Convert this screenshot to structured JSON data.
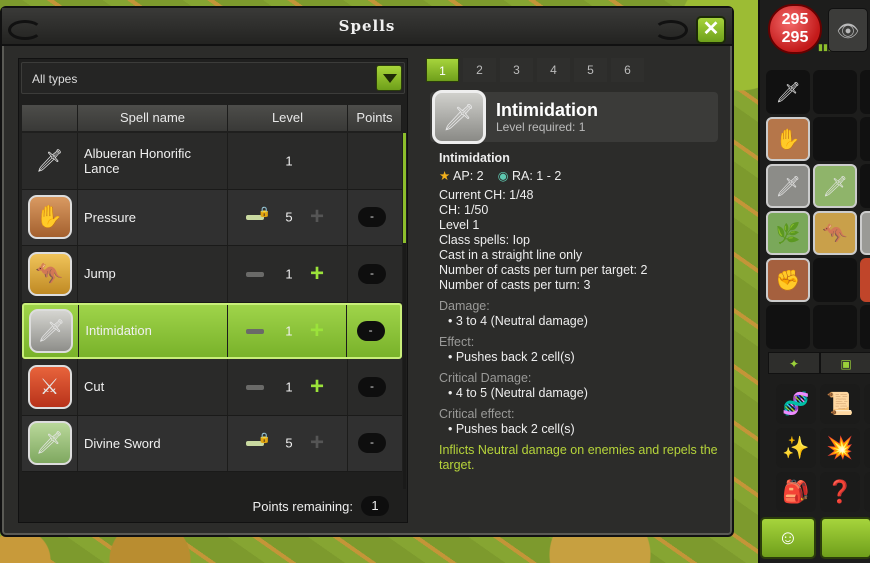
{
  "window": {
    "title": "Spells",
    "close_label": "✕"
  },
  "filter": {
    "selected": "All types"
  },
  "table": {
    "columns": [
      "Spell name",
      "Level",
      "Points"
    ],
    "rows": [
      {
        "icon": "lance-icon",
        "glyph": "🗡",
        "name": "Albueran Honorific Lance",
        "level": "1",
        "locked": false,
        "minus": false,
        "plus": false,
        "points": "",
        "selected": false
      },
      {
        "icon": "pressure-icon",
        "glyph": "✋",
        "name": "Pressure",
        "level": "5",
        "locked": true,
        "minus": true,
        "plus": false,
        "points": "-",
        "selected": false
      },
      {
        "icon": "jump-icon",
        "glyph": "🦘",
        "name": "Jump",
        "level": "1",
        "locked": false,
        "minus": true,
        "plus": true,
        "points": "-",
        "selected": false
      },
      {
        "icon": "intimidation-icon",
        "glyph": "🗡",
        "name": "Intimidation",
        "level": "1",
        "locked": false,
        "minus": true,
        "plus": true,
        "points": "-",
        "selected": true
      },
      {
        "icon": "cut-icon",
        "glyph": "⚔",
        "name": "Cut",
        "level": "1",
        "locked": false,
        "minus": true,
        "plus": true,
        "points": "-",
        "selected": false
      },
      {
        "icon": "divine-sword-icon",
        "glyph": "🗡",
        "name": "Divine Sword",
        "level": "5",
        "locked": true,
        "minus": true,
        "plus": false,
        "points": "-",
        "selected": false
      }
    ],
    "remaining_label": "Points remaining:",
    "remaining_value": "1"
  },
  "level_tabs": [
    "1",
    "2",
    "3",
    "4",
    "5",
    "6"
  ],
  "detail": {
    "name": "Intimidation",
    "level_required": "Level required: 1",
    "subtitle": "Intimidation",
    "ap": "AP: 2",
    "ra": "RA: 1 - 2",
    "lines": [
      "Current CH: 1/48",
      "CH: 1/50",
      "Level 1",
      "Class spells: Iop",
      "Cast in a straight line only",
      "Number of casts per turn per target: 2",
      "Number of casts per turn: 3"
    ],
    "damage_label": "Damage:",
    "damage": "• 3 to 4 (Neutral damage)",
    "effect_label": "Effect:",
    "effect": "• Pushes back 2 cell(s)",
    "crit_damage_label": "Critical Damage:",
    "crit_damage": "• 4 to 5 (Neutral damage)",
    "crit_effect_label": "Critical effect:",
    "crit_effect": "• Pushes back 2 cell(s)",
    "description": "Inflicts Neutral damage on enemies and repels the target."
  },
  "hud": {
    "hp_current": "295",
    "hp_max": "295"
  },
  "colors": {
    "accent": "#8dbf2c",
    "panel": "#2c2c2a",
    "selected_row": "#8cc43a"
  }
}
